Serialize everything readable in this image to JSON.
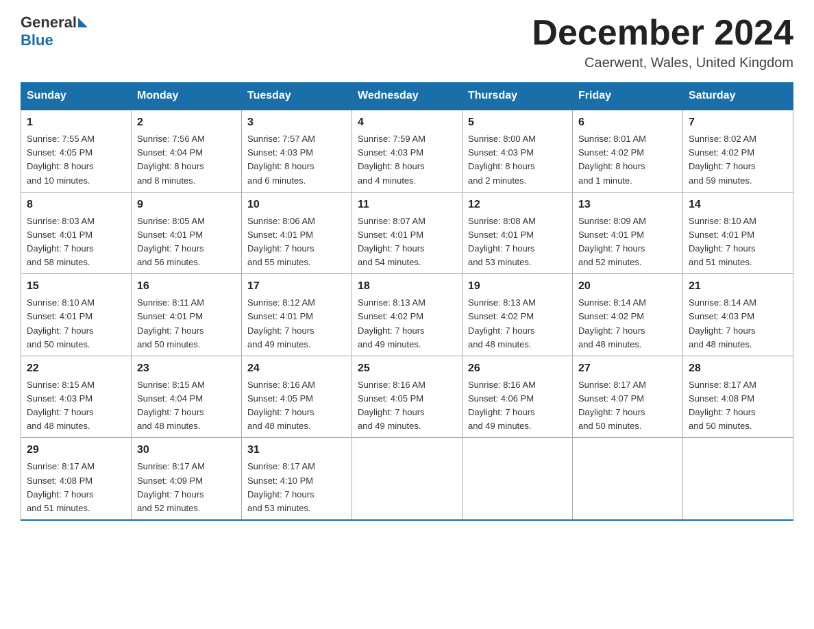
{
  "header": {
    "logo_general": "General",
    "logo_blue": "Blue",
    "month_title": "December 2024",
    "location": "Caerwent, Wales, United Kingdom"
  },
  "days_of_week": [
    "Sunday",
    "Monday",
    "Tuesday",
    "Wednesday",
    "Thursday",
    "Friday",
    "Saturday"
  ],
  "weeks": [
    [
      {
        "day": "1",
        "info": "Sunrise: 7:55 AM\nSunset: 4:05 PM\nDaylight: 8 hours\nand 10 minutes."
      },
      {
        "day": "2",
        "info": "Sunrise: 7:56 AM\nSunset: 4:04 PM\nDaylight: 8 hours\nand 8 minutes."
      },
      {
        "day": "3",
        "info": "Sunrise: 7:57 AM\nSunset: 4:03 PM\nDaylight: 8 hours\nand 6 minutes."
      },
      {
        "day": "4",
        "info": "Sunrise: 7:59 AM\nSunset: 4:03 PM\nDaylight: 8 hours\nand 4 minutes."
      },
      {
        "day": "5",
        "info": "Sunrise: 8:00 AM\nSunset: 4:03 PM\nDaylight: 8 hours\nand 2 minutes."
      },
      {
        "day": "6",
        "info": "Sunrise: 8:01 AM\nSunset: 4:02 PM\nDaylight: 8 hours\nand 1 minute."
      },
      {
        "day": "7",
        "info": "Sunrise: 8:02 AM\nSunset: 4:02 PM\nDaylight: 7 hours\nand 59 minutes."
      }
    ],
    [
      {
        "day": "8",
        "info": "Sunrise: 8:03 AM\nSunset: 4:01 PM\nDaylight: 7 hours\nand 58 minutes."
      },
      {
        "day": "9",
        "info": "Sunrise: 8:05 AM\nSunset: 4:01 PM\nDaylight: 7 hours\nand 56 minutes."
      },
      {
        "day": "10",
        "info": "Sunrise: 8:06 AM\nSunset: 4:01 PM\nDaylight: 7 hours\nand 55 minutes."
      },
      {
        "day": "11",
        "info": "Sunrise: 8:07 AM\nSunset: 4:01 PM\nDaylight: 7 hours\nand 54 minutes."
      },
      {
        "day": "12",
        "info": "Sunrise: 8:08 AM\nSunset: 4:01 PM\nDaylight: 7 hours\nand 53 minutes."
      },
      {
        "day": "13",
        "info": "Sunrise: 8:09 AM\nSunset: 4:01 PM\nDaylight: 7 hours\nand 52 minutes."
      },
      {
        "day": "14",
        "info": "Sunrise: 8:10 AM\nSunset: 4:01 PM\nDaylight: 7 hours\nand 51 minutes."
      }
    ],
    [
      {
        "day": "15",
        "info": "Sunrise: 8:10 AM\nSunset: 4:01 PM\nDaylight: 7 hours\nand 50 minutes."
      },
      {
        "day": "16",
        "info": "Sunrise: 8:11 AM\nSunset: 4:01 PM\nDaylight: 7 hours\nand 50 minutes."
      },
      {
        "day": "17",
        "info": "Sunrise: 8:12 AM\nSunset: 4:01 PM\nDaylight: 7 hours\nand 49 minutes."
      },
      {
        "day": "18",
        "info": "Sunrise: 8:13 AM\nSunset: 4:02 PM\nDaylight: 7 hours\nand 49 minutes."
      },
      {
        "day": "19",
        "info": "Sunrise: 8:13 AM\nSunset: 4:02 PM\nDaylight: 7 hours\nand 48 minutes."
      },
      {
        "day": "20",
        "info": "Sunrise: 8:14 AM\nSunset: 4:02 PM\nDaylight: 7 hours\nand 48 minutes."
      },
      {
        "day": "21",
        "info": "Sunrise: 8:14 AM\nSunset: 4:03 PM\nDaylight: 7 hours\nand 48 minutes."
      }
    ],
    [
      {
        "day": "22",
        "info": "Sunrise: 8:15 AM\nSunset: 4:03 PM\nDaylight: 7 hours\nand 48 minutes."
      },
      {
        "day": "23",
        "info": "Sunrise: 8:15 AM\nSunset: 4:04 PM\nDaylight: 7 hours\nand 48 minutes."
      },
      {
        "day": "24",
        "info": "Sunrise: 8:16 AM\nSunset: 4:05 PM\nDaylight: 7 hours\nand 48 minutes."
      },
      {
        "day": "25",
        "info": "Sunrise: 8:16 AM\nSunset: 4:05 PM\nDaylight: 7 hours\nand 49 minutes."
      },
      {
        "day": "26",
        "info": "Sunrise: 8:16 AM\nSunset: 4:06 PM\nDaylight: 7 hours\nand 49 minutes."
      },
      {
        "day": "27",
        "info": "Sunrise: 8:17 AM\nSunset: 4:07 PM\nDaylight: 7 hours\nand 50 minutes."
      },
      {
        "day": "28",
        "info": "Sunrise: 8:17 AM\nSunset: 4:08 PM\nDaylight: 7 hours\nand 50 minutes."
      }
    ],
    [
      {
        "day": "29",
        "info": "Sunrise: 8:17 AM\nSunset: 4:08 PM\nDaylight: 7 hours\nand 51 minutes."
      },
      {
        "day": "30",
        "info": "Sunrise: 8:17 AM\nSunset: 4:09 PM\nDaylight: 7 hours\nand 52 minutes."
      },
      {
        "day": "31",
        "info": "Sunrise: 8:17 AM\nSunset: 4:10 PM\nDaylight: 7 hours\nand 53 minutes."
      },
      {
        "day": "",
        "info": ""
      },
      {
        "day": "",
        "info": ""
      },
      {
        "day": "",
        "info": ""
      },
      {
        "day": "",
        "info": ""
      }
    ]
  ]
}
